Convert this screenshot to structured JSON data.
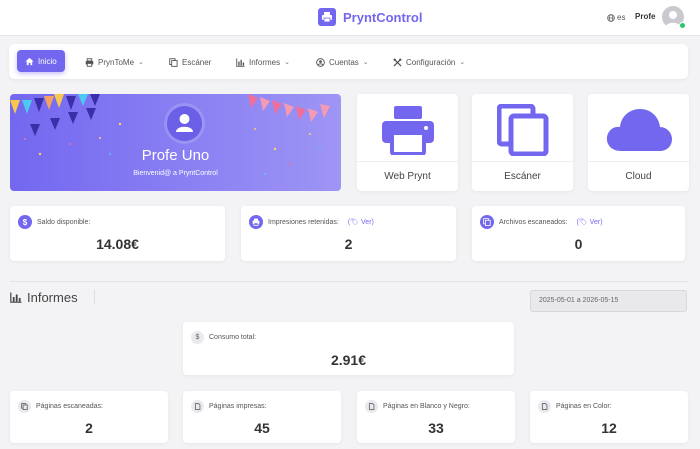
{
  "header": {
    "brand": "PryntControl",
    "language": "es",
    "user_name": "Profe"
  },
  "nav": {
    "items": [
      {
        "label": "Inicio",
        "icon": "home-icon",
        "active": true
      },
      {
        "label": "PrynToMe",
        "icon": "printer-icon",
        "dropdown": true
      },
      {
        "label": "Escáner",
        "icon": "copy-icon"
      },
      {
        "label": "Informes",
        "icon": "bar-chart-icon",
        "dropdown": true
      },
      {
        "label": "Cuentas",
        "icon": "user-circle-icon",
        "dropdown": true
      },
      {
        "label": "Configuración",
        "icon": "tools-icon",
        "dropdown": true
      }
    ]
  },
  "welcome": {
    "name": "Profe Uno",
    "subtitle": "Bienvenid@ a PryntControl"
  },
  "services": [
    {
      "label": "Web Prynt",
      "icon": "printer-icon"
    },
    {
      "label": "Escáner",
      "icon": "copy-icon"
    },
    {
      "label": "Cloud",
      "icon": "cloud-icon"
    }
  ],
  "stats": [
    {
      "label": "Saldo disponible:",
      "value": "14.08€",
      "icon": "dollar-icon",
      "link": ""
    },
    {
      "label": "Impresiones retenidas:",
      "value": "2",
      "icon": "printer-icon",
      "link": "Ver"
    },
    {
      "label": "Archivos escaneados:",
      "value": "0",
      "icon": "copy-icon",
      "link": "Ver"
    }
  ],
  "reports": {
    "title": "Informes",
    "date_range": "2025-05-01 a 2026-05-15",
    "total": {
      "label": "Consumo total:",
      "value": "2.91€"
    },
    "cards": [
      {
        "label": "Páginas escaneadas:",
        "value": "2",
        "icon": "copy-icon"
      },
      {
        "label": "Páginas impresas:",
        "value": "45",
        "icon": "file-icon"
      },
      {
        "label": "Páginas en Blanco y Negro:",
        "value": "33",
        "icon": "file-icon"
      },
      {
        "label": "Páginas en Color:",
        "value": "12",
        "icon": "file-icon"
      }
    ]
  },
  "colors": {
    "accent": "#7367f0",
    "online": "#28c76f"
  }
}
